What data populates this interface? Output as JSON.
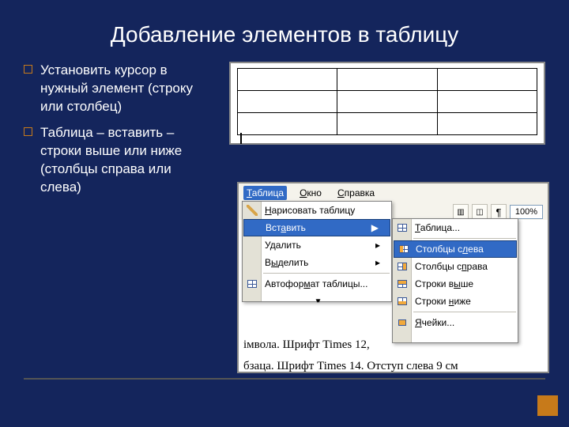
{
  "title": "Добавление элементов в таблицу",
  "bullets": [
    "Установить курсор в нужный элемент (строку или столбец)",
    "Таблица – вставить – строки выше или ниже (столбцы справа или слева)"
  ],
  "menubar": {
    "items": [
      "Таблица",
      "Окно",
      "Справка"
    ]
  },
  "main_menu": {
    "draw": "Нарисовать таблицу",
    "insert": "Вставить",
    "delete": "Удалить",
    "select": "Выделить",
    "autoformat": "Автоформат таблицы..."
  },
  "submenu": {
    "table": "Таблица...",
    "cols_left": "Столбцы слева",
    "cols_right": "Столбцы справа",
    "rows_above": "Строки выше",
    "rows_below": "Строки ниже",
    "cells": "Ячейки..."
  },
  "toolbar": {
    "zoom": "100%",
    "pilcrow": "¶"
  },
  "doc_text": {
    "line1": "імвола. Шрифт  Times 12,",
    "line2": "бзаца. Шрифт Times 14. Отступ слева 9 см"
  }
}
